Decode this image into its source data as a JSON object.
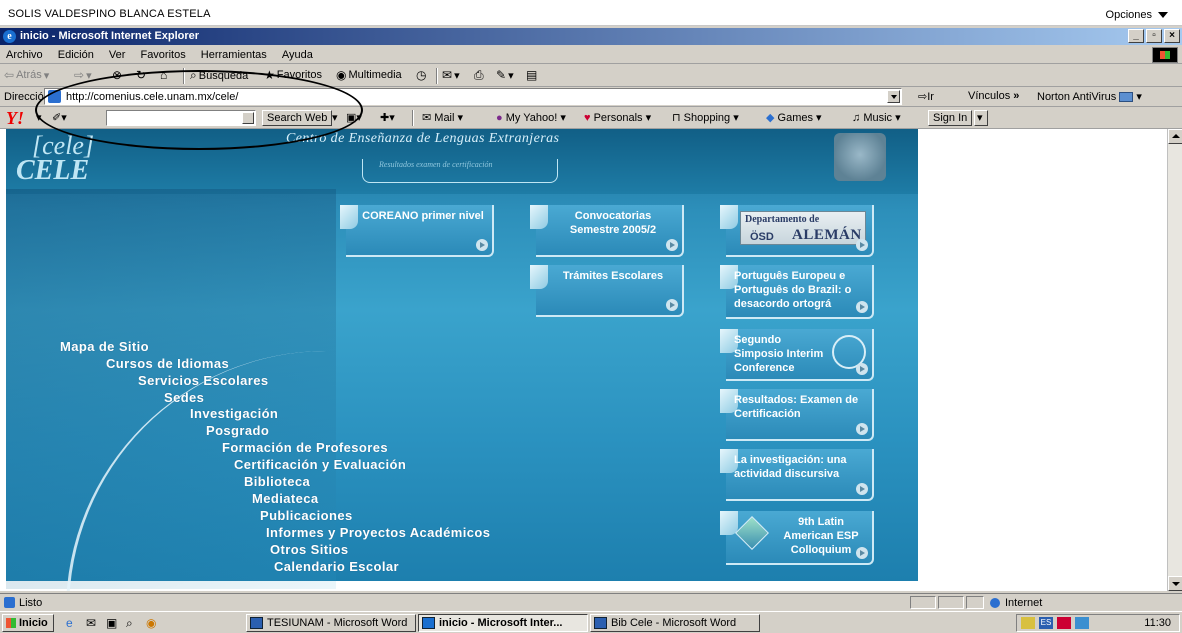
{
  "user_bar": {
    "name": "SOLIS VALDESPINO BLANCA ESTELA",
    "options": "Opciones"
  },
  "window": {
    "title": "inicio - Microsoft Internet Explorer",
    "min": "_",
    "max": "▫",
    "close": "×"
  },
  "menu": [
    "Archivo",
    "Edición",
    "Ver",
    "Favoritos",
    "Herramientas",
    "Ayuda"
  ],
  "toolbar": {
    "back": "Atrás",
    "search": "Búsqueda",
    "favorites": "Favoritos",
    "multimedia": "Multimedia"
  },
  "address": {
    "label": "Dirección",
    "url": "http://comenius.cele.unam.mx/cele/",
    "go": "Ir",
    "links": "Vínculos",
    "norton": "Norton AntiVirus"
  },
  "yahoo": {
    "search_button": "Search Web",
    "items": [
      "Mail",
      "My Yahoo!",
      "Personals",
      "Shopping",
      "Games",
      "Music"
    ],
    "signin": "Sign In"
  },
  "site": {
    "logo_top": "[cele]",
    "logo_bottom": "CELE",
    "title": "Centro de Enseñanza de Lenguas Extranjeras",
    "subtitle": "Resultados examen de certificación",
    "tiles": [
      {
        "label": "COREANO primer nivel"
      },
      {
        "label": "Convocatorias Semestre 2005/2"
      },
      {
        "label": "Departamento de",
        "osd": "ÖSD",
        "aleman": "ALEMÁN"
      },
      {
        "label": "Trámites Escolares"
      },
      {
        "label": "Português Europeu e Português do Brazil: o desacordo ortográ"
      },
      {
        "label": "Segundo Simposio Interim Conference"
      },
      {
        "label": "Resultados: Examen de Certificación"
      },
      {
        "label": "La investigación: una actividad discursiva"
      },
      {
        "label": "9th Latin American ESP Colloquium"
      }
    ],
    "sitemap": [
      "Mapa de Sitio",
      "Cursos de Idiomas",
      "Servicios Escolares",
      "Sedes",
      "Investigación",
      "Posgrado",
      "Formación de Profesores",
      "Certificación y Evaluación",
      "Biblioteca",
      "Mediateca",
      "Publicaciones",
      "Informes y Proyectos Académicos",
      "Otros Sitios",
      "Calendario Escolar"
    ]
  },
  "status": {
    "text": "Listo",
    "zone": "Internet"
  },
  "taskbar": {
    "start": "Inicio",
    "buttons": [
      "TESIUNAM - Microsoft Word",
      "inicio - Microsoft Inter...",
      "Bib Cele - Microsoft Word"
    ],
    "clock": "11:30"
  }
}
